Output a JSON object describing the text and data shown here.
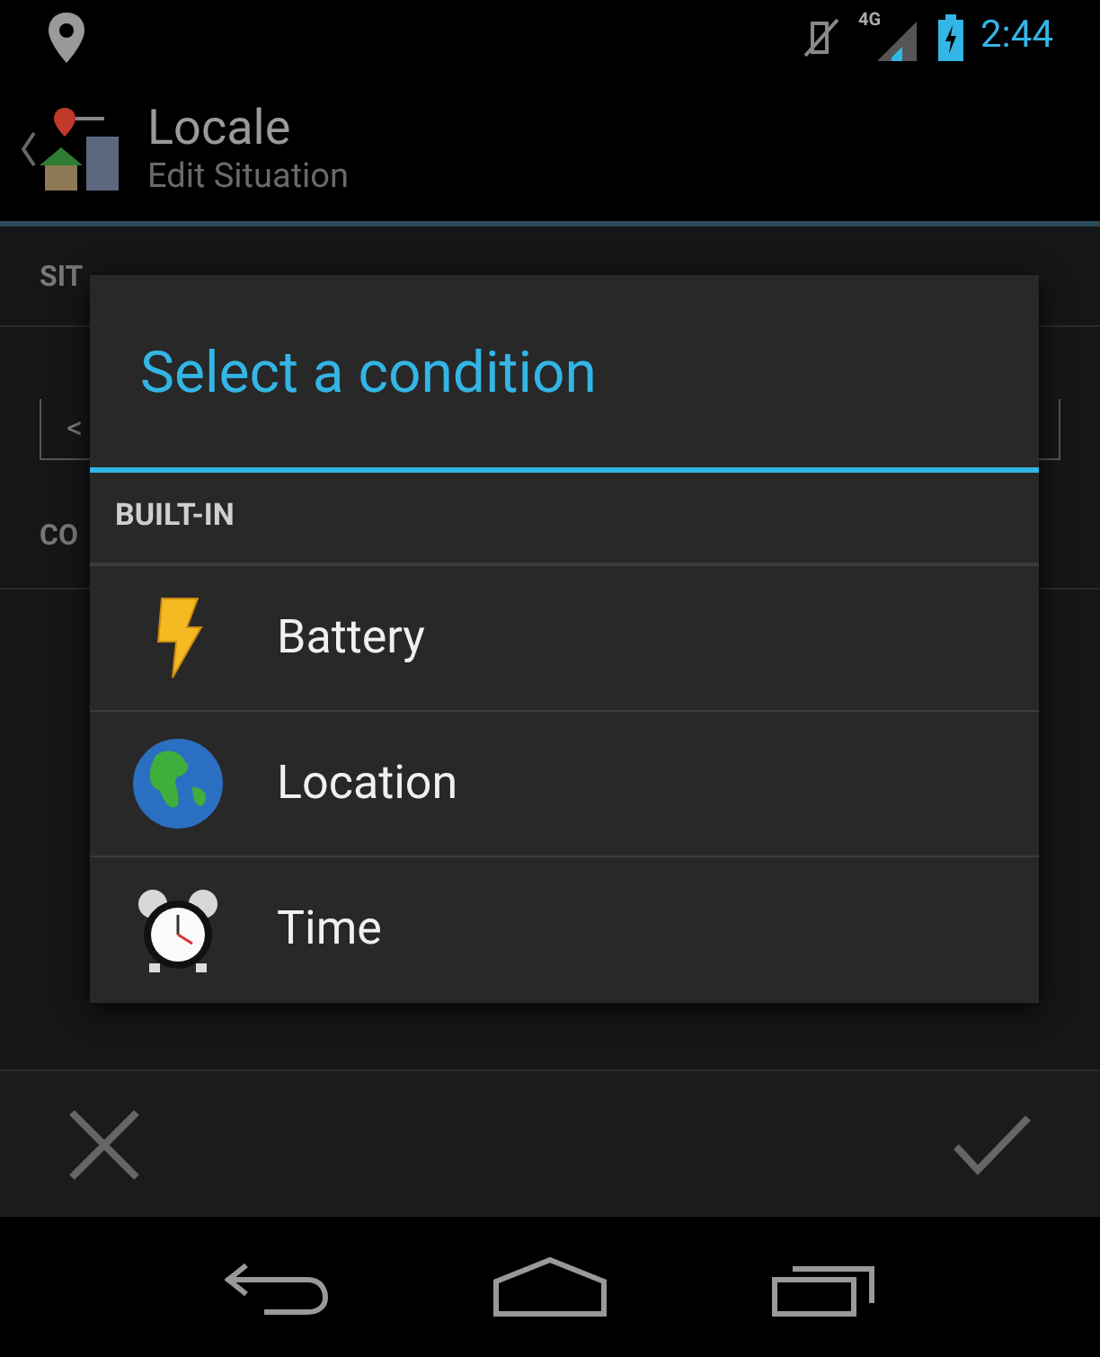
{
  "status_bar": {
    "network": "4G",
    "time": "2:44"
  },
  "app_bar": {
    "title": "Locale",
    "subtitle": "Edit Situation"
  },
  "background": {
    "label_1": "SIT",
    "field_value": "<",
    "label_2": "CO"
  },
  "dialog": {
    "title": "Select a condition",
    "section": "BUILT-IN",
    "items": [
      {
        "label": "Battery",
        "kind": "battery"
      },
      {
        "label": "Location",
        "kind": "location"
      },
      {
        "label": "Time",
        "kind": "time"
      }
    ]
  }
}
